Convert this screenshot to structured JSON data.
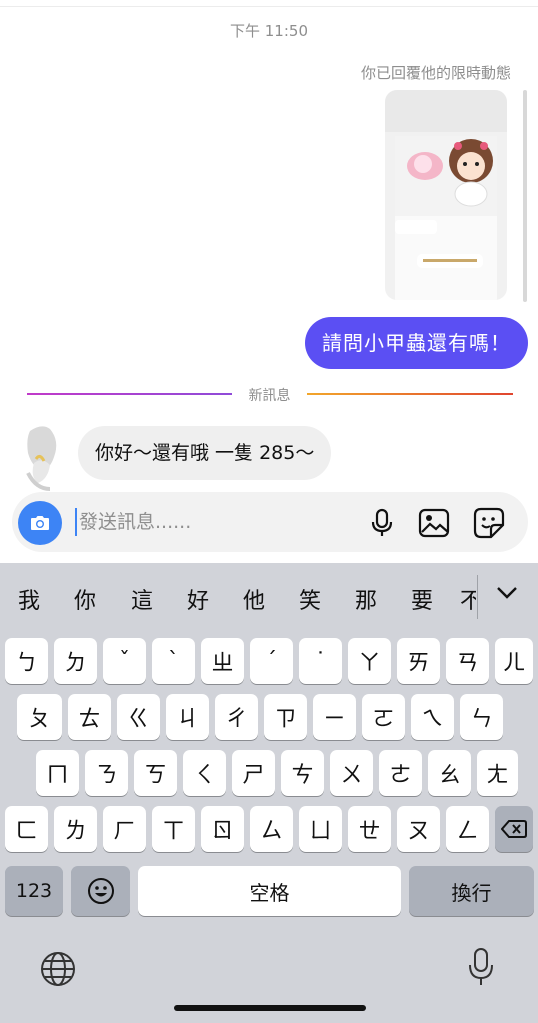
{
  "chat": {
    "timestamp": "下午 11:50",
    "story_reply_note": "你已回覆他的限時動態",
    "outgoing_message": "請問小甲蟲還有嗎！",
    "new_messages_label": "新訊息",
    "incoming_message": "你好～還有哦 一隻 285～"
  },
  "composer": {
    "placeholder": "發送訊息......"
  },
  "keyboard": {
    "candidates": [
      "我",
      "你",
      "這",
      "好",
      "他",
      "笑",
      "那",
      "要",
      "不"
    ],
    "row1": [
      "ㄅ",
      "ㄉ",
      "ˇ",
      "ˋ",
      "ㄓ",
      "ˊ",
      "˙",
      "ㄚ",
      "ㄞ",
      "ㄢ",
      "ㄦ"
    ],
    "row2": [
      "ㄆ",
      "ㄊ",
      "ㄍ",
      "ㄐ",
      "ㄔ",
      "ㄗ",
      "ㄧ",
      "ㄛ",
      "ㄟ",
      "ㄣ"
    ],
    "row3": [
      "ㄇ",
      "ㄋ",
      "ㄎ",
      "ㄑ",
      "ㄕ",
      "ㄘ",
      "ㄨ",
      "ㄜ",
      "ㄠ",
      "ㄤ"
    ],
    "row4": [
      "ㄈ",
      "ㄌ",
      "ㄏ",
      "ㄒ",
      "ㄖ",
      "ㄙ",
      "ㄩ",
      "ㄝ",
      "ㄡ",
      "ㄥ"
    ],
    "numbers_label": "123",
    "space_label": "空格",
    "return_label": "換行"
  },
  "colors": {
    "outgoing_bubble": "#5b4ff3",
    "camera_button": "#3d84f5",
    "keyboard_bg": "#d1d3d9"
  }
}
